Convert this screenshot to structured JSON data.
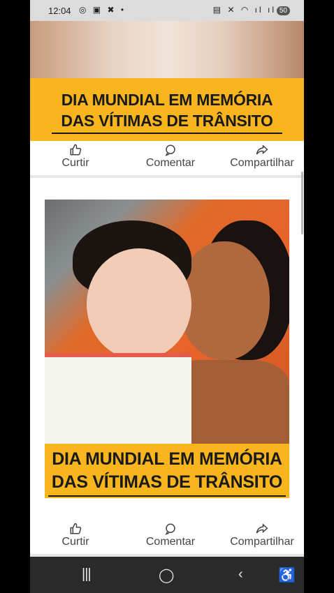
{
  "status_bar": {
    "time": "12:04",
    "left_icons": "◎ ▣ ✖ •",
    "right_icons": "▤ ✕ ◠ ıl ıl",
    "battery": "50"
  },
  "posts": [
    {
      "banner_line1": "DIA MUNDIAL EM MEMÓRIA",
      "banner_line2": "DAS VÍTIMAS DE TRÂNSITO",
      "actions": {
        "like": "Curtir",
        "comment": "Comentar",
        "share": "Compartilhar"
      }
    },
    {
      "banner_line1": "DIA MUNDIAL EM MEMÓRIA",
      "banner_line2": "DAS VÍTIMAS DE TRÂNSITO",
      "actions": {
        "like": "Curtir",
        "comment": "Comentar",
        "share": "Compartilhar"
      }
    }
  ],
  "nav_bar": {
    "recent_icon": "|||",
    "home_icon": "◯",
    "back_icon": "‹",
    "accessibility_icon": "♿"
  },
  "colors": {
    "banner": "#f8b51e",
    "navbar": "#2a2a2a"
  }
}
